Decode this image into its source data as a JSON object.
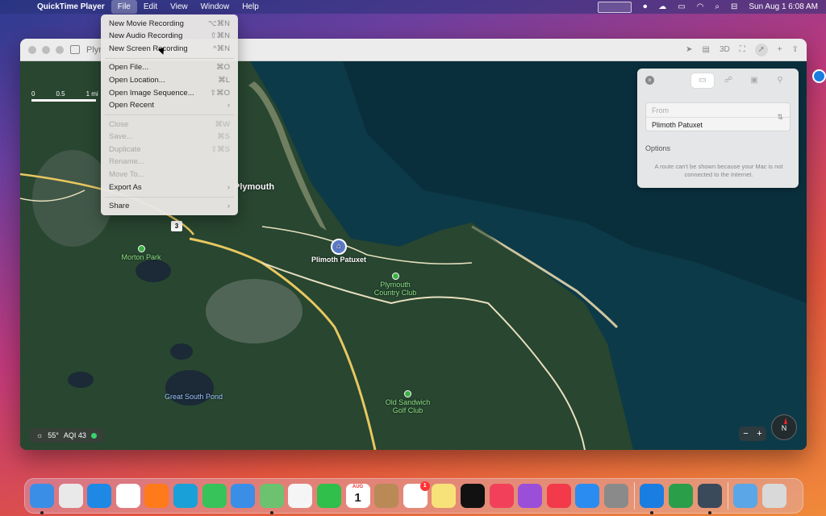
{
  "menubar": {
    "apple_icon": "apple-icon",
    "app_name": "QuickTime Player",
    "items": [
      "File",
      "Edit",
      "View",
      "Window",
      "Help"
    ],
    "clock": "Sun Aug 1  6:08 AM"
  },
  "file_menu": {
    "items": [
      {
        "label": "New Movie Recording",
        "shortcut": "⌥⌘N",
        "enabled": true
      },
      {
        "label": "New Audio Recording",
        "shortcut": "⇧⌘N",
        "enabled": true
      },
      {
        "label": "New Screen Recording",
        "shortcut": "^⌘N",
        "enabled": true
      },
      {
        "label": "Open File...",
        "shortcut": "⌘O",
        "enabled": true
      },
      {
        "label": "Open Location...",
        "shortcut": "⌘L",
        "enabled": true
      },
      {
        "label": "Open Image Sequence...",
        "shortcut": "⇧⌘O",
        "enabled": true
      },
      {
        "label": "Open Recent",
        "shortcut": "›",
        "enabled": true
      },
      {
        "label": "Close",
        "shortcut": "⌘W",
        "enabled": false
      },
      {
        "label": "Save...",
        "shortcut": "⌘S",
        "enabled": false
      },
      {
        "label": "Duplicate",
        "shortcut": "⇧⌘S",
        "enabled": false
      },
      {
        "label": "Rename...",
        "shortcut": "",
        "enabled": false
      },
      {
        "label": "Move To...",
        "shortcut": "",
        "enabled": false
      },
      {
        "label": "Export As",
        "shortcut": "›",
        "enabled": true
      },
      {
        "label": "Share",
        "shortcut": "›",
        "enabled": true
      }
    ]
  },
  "maps_window": {
    "title": "Plym",
    "toolbar": {
      "three_d": "3D"
    },
    "scale": {
      "labels": [
        "0",
        "0.5",
        "1 mi"
      ]
    },
    "places": {
      "plymouth": "Plymouth",
      "morton_park": "Morton Park",
      "plimoth_patuxet": "Plimoth Patuxet",
      "plymouth_country_club": "Plymouth Country Club",
      "great_south_pond": "Great South Pond",
      "old_sandwich_golf_club": "Old Sandwich Golf Club",
      "route_shield": "3"
    },
    "weather": {
      "temp": "55°",
      "aqi": "AQI 43"
    },
    "zoom": {
      "minus": "−",
      "plus": "+"
    },
    "compass": "N",
    "directions": {
      "from_placeholder": "From",
      "to_value": "Plimoth Patuxet",
      "options_label": "Options",
      "message": "A route can't be shown because your Mac is not connected to the Internet."
    }
  },
  "dock": {
    "apps": [
      {
        "name": "Finder",
        "color": "#3a8ee6",
        "running": true
      },
      {
        "name": "Launchpad",
        "color": "#e9e9e9",
        "running": false
      },
      {
        "name": "Safari",
        "color": "#1e88e5",
        "running": false
      },
      {
        "name": "Chrome",
        "color": "#ffffff",
        "running": false
      },
      {
        "name": "Firefox",
        "color": "#ff7a1a",
        "running": false
      },
      {
        "name": "Edge",
        "color": "#1aa0d8",
        "running": false
      },
      {
        "name": "Messages",
        "color": "#37c35a",
        "running": false
      },
      {
        "name": "Mail",
        "color": "#3a8ee6",
        "running": false
      },
      {
        "name": "Maps",
        "color": "#6cc26f",
        "running": true
      },
      {
        "name": "Photos",
        "color": "#f5f5f5",
        "running": false
      },
      {
        "name": "FaceTime",
        "color": "#2fbf4a",
        "running": false
      },
      {
        "name": "Calendar",
        "color": "#ffffff",
        "running": false,
        "month": "AUG",
        "day": "1"
      },
      {
        "name": "Contacts",
        "color": "#b98a55",
        "running": false
      },
      {
        "name": "Reminders",
        "color": "#ffffff",
        "running": false,
        "badge": "1"
      },
      {
        "name": "Notes",
        "color": "#f7e27a",
        "running": false
      },
      {
        "name": "TV",
        "color": "#111111",
        "running": false
      },
      {
        "name": "Music",
        "color": "#f2405a",
        "running": false
      },
      {
        "name": "Podcasts",
        "color": "#9b4fd8",
        "running": false
      },
      {
        "name": "News",
        "color": "#f23a4a",
        "running": false
      },
      {
        "name": "App Store",
        "color": "#2a8cf0",
        "running": false
      },
      {
        "name": "System Preferences",
        "color": "#8a8a8a",
        "running": false
      },
      {
        "name": "TeamViewer",
        "color": "#1a7de0",
        "running": true
      },
      {
        "name": "Terminal App",
        "color": "#2b9e4a",
        "running": false
      },
      {
        "name": "QuickTime Player",
        "color": "#3a4a5a",
        "running": true
      },
      {
        "name": "Downloads",
        "color": "#5aa6e6",
        "running": false
      },
      {
        "name": "Trash",
        "color": "#d9d9d9",
        "running": false
      }
    ]
  }
}
